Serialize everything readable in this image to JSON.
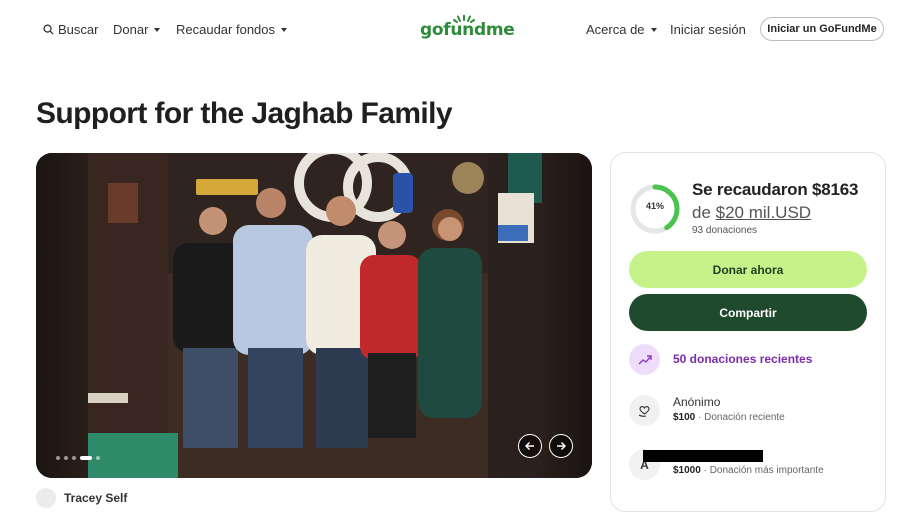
{
  "header": {
    "search_label": "Buscar",
    "donate_label": "Donar",
    "fundraise_label": "Recaudar fondos",
    "logo_text": "gofundme",
    "about_label": "Acerca de",
    "signin_label": "Iniciar sesión",
    "start_label": "Iniciar un GoFundMe"
  },
  "campaign": {
    "title": "Support for the Jaghab Family"
  },
  "carousel": {
    "slide_count": 5,
    "active_slide": 4
  },
  "progress": {
    "percent_label": "41%",
    "percent_value": 41,
    "raised_text": "Se recaudaron $8163",
    "goal_prefix": "de ",
    "goal_amount": "$20 mil.USD",
    "donations_count": "93 donaciones"
  },
  "actions": {
    "donate_label": "Donar ahora",
    "share_label": "Compartir"
  },
  "recent": {
    "label": "50 donaciones recientes"
  },
  "donations": [
    {
      "name": "Anónimo",
      "amount": "$100",
      "note": "Donación reciente"
    },
    {
      "name": "A",
      "amount": "$1000",
      "note": "Donación más importante"
    }
  ],
  "organizer": {
    "name": "Tracey Self"
  },
  "colors": {
    "brand_green": "#2e8b3a",
    "donate_bg": "#c6f28a",
    "share_bg": "#1f4a2e",
    "recent_purple": "#7b2ca7",
    "ring_green": "#4cc34f"
  }
}
